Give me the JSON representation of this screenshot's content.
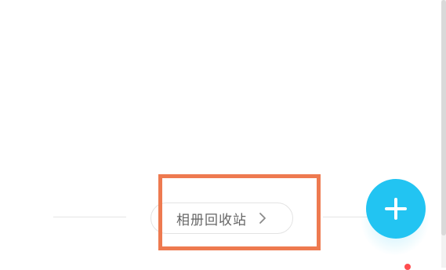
{
  "album": {
    "recycle_bin_label": "相册回收站",
    "recycle_bin_chevron_icon": "chevron-right-icon"
  },
  "fab": {
    "icon": "plus-icon",
    "color": "#22c4f2"
  },
  "highlight": {
    "color": "#ee7a50"
  },
  "notification_dot": {
    "color": "#ff4d4f"
  }
}
